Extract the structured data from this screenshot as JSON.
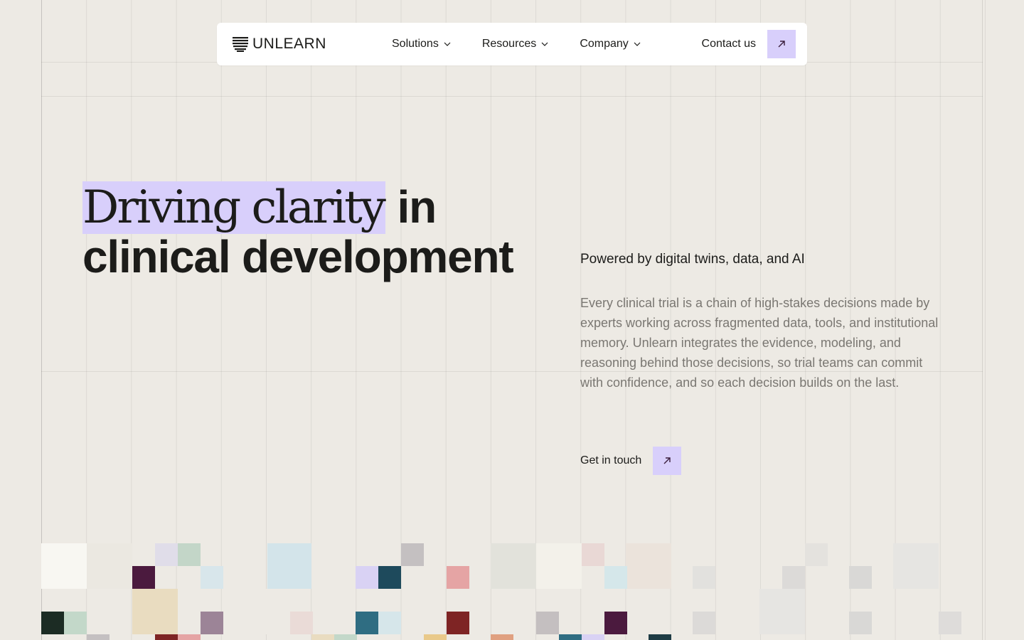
{
  "nav": {
    "logo_text": "UNLEARN",
    "menu": [
      {
        "label": "Solutions"
      },
      {
        "label": "Resources"
      },
      {
        "label": "Company"
      }
    ],
    "contact_label": "Contact us"
  },
  "hero": {
    "title_highlight": "Driving clarity",
    "title_rest_line1": " in",
    "title_line2": "clinical development",
    "subhead": "Powered by digital twins, data, and AI",
    "body": "Every clinical trial is a chain of high-stakes decisions made by experts working across fragmented data, tools, and institutional memory. Unlearn integrates the evidence, modeling, and reasoning behind those decisions, so trial teams can commit with confidence, and so each decision builds on the last.",
    "cta_label": "Get in touch"
  },
  "colors": {
    "background": "#edeae4",
    "accent": "#d8cffb",
    "text": "#1c1c1a",
    "muted_text": "#7a7772"
  }
}
